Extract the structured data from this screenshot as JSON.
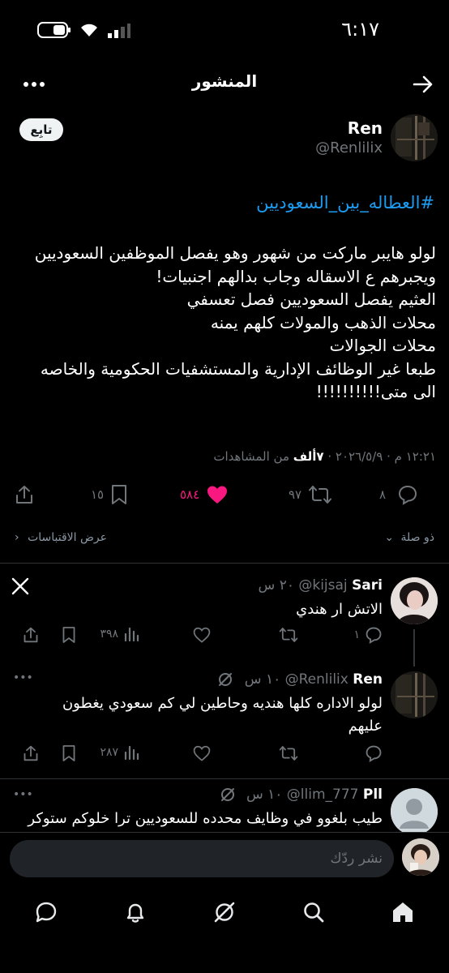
{
  "status_bar": {
    "time": "٦:١٧"
  },
  "header": {
    "title": "المنشور"
  },
  "post": {
    "author_name": "Ren",
    "author_handle": "@Renlilix",
    "follow_label": "تابِع",
    "hashtag": "#العطاله_بين_السعوديين",
    "body_lines": [
      "لولو هايبر ماركت من شهور وهو يفصل الموظفين السعوديين",
      "ويجبرهم ع الاسقاله وجاب بدالهم اجنبيات!",
      "العثيم يفصل السعوديين فصل تعسفي",
      "محلات الذهب والمولات كلهم يمنه",
      "محلات الجوالات",
      "طبعا غير الوظائف الإدارية والمستشفيات الحكومية والخاصه",
      "الى متى!!!!!!!!!!"
    ],
    "timestamp": "١٢:٢١ م · ٢٠٢٦/٥/٩",
    "views_value": "٧ألف",
    "views_label": "من المشاهدات",
    "replies": "٨",
    "reposts": "٩٧",
    "likes": "٥٨٤",
    "bookmarks": "١٥",
    "related_label": "ذو صلة",
    "quotes_label": "عرض الاقتباسات"
  },
  "replies": [
    {
      "name": "Sari",
      "handle": "@kijsaj",
      "time": "٢٠ س",
      "text": "الاتش ار هندي",
      "reply_count": "١",
      "repost_count": "",
      "like_count": "",
      "view_count": "٣٩٨"
    },
    {
      "name": "Ren",
      "handle": "@Renlilix",
      "time": "١٠ س",
      "text_lines": [
        "لولو الاداره كلها هنديه وحاطين لي كم سعودي يغطون",
        "عليهم"
      ],
      "view_count": "٢٨٧"
    },
    {
      "name": "Pll",
      "handle": "@llim_777",
      "time": "١٠ س",
      "text": "طيب بلغوو في وظايف محدده للسعوديين ترا خلوكم ستوكر"
    }
  ],
  "composer": {
    "placeholder": "نشر ردّك"
  },
  "colors": {
    "accent": "#1d9bf0",
    "like": "#f91880",
    "muted": "#71767b",
    "background": "#000000"
  }
}
